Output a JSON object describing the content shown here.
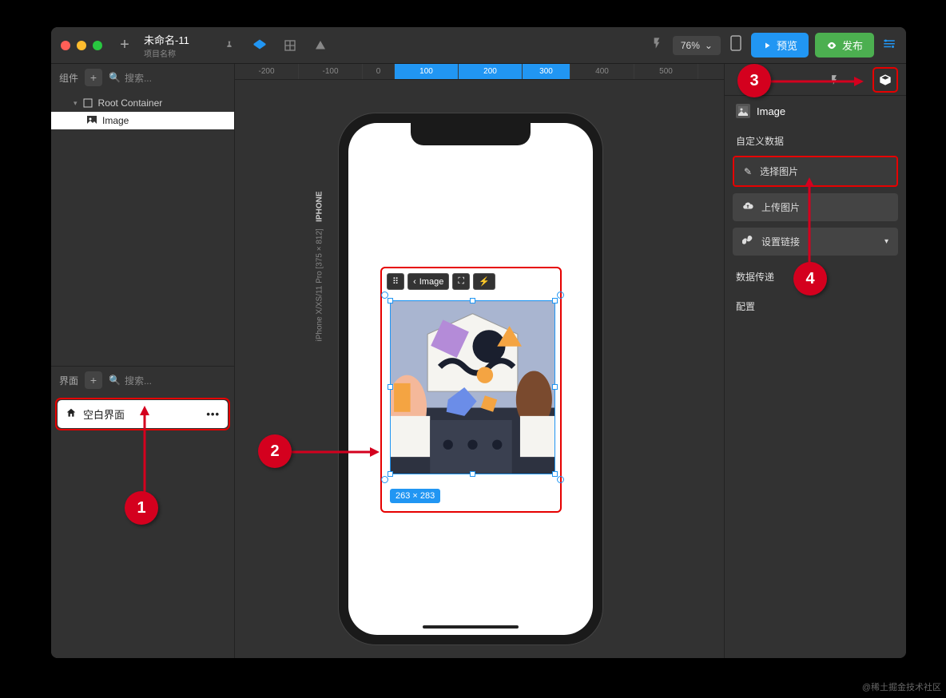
{
  "titlebar": {
    "project_name": "未命名-11",
    "project_sub": "项目名称",
    "zoom": "76%",
    "preview": "预览",
    "publish": "发布"
  },
  "left": {
    "components_label": "组件",
    "search_placeholder": "搜索...",
    "root_label": "Root Container",
    "image_label": "Image",
    "pages_label": "界面",
    "blank_page": "空白界面"
  },
  "canvas": {
    "ruler": [
      "-200",
      "-100",
      "0",
      "100",
      "200",
      "300",
      "400",
      "500"
    ],
    "phone_label_bold": "IPHONE",
    "phone_label_rest": "iPhone X/XS/11 Pro [375 × 812]",
    "img_toolbar_label": "Image",
    "size_badge": "263 × 283"
  },
  "right": {
    "component_name": "Image",
    "custom_data": "自定义数据",
    "select_image": "选择图片",
    "upload_image": "上传图片",
    "set_link": "设置链接",
    "data_transfer": "数据传递",
    "config": "配置"
  },
  "callouts": {
    "c1": "1",
    "c2": "2",
    "c3": "3",
    "c4": "4"
  },
  "watermark": "@稀土掘金技术社区"
}
